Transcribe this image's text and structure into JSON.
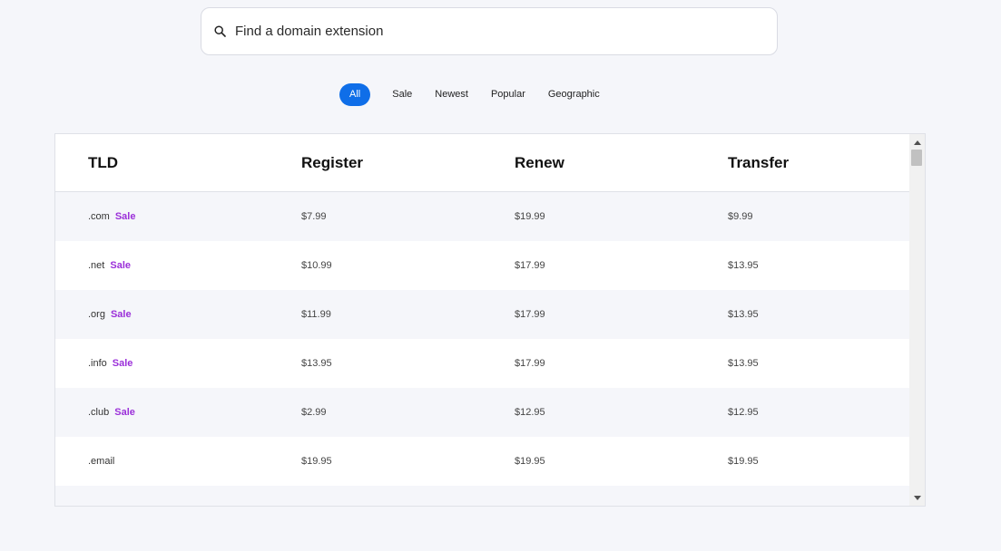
{
  "search": {
    "placeholder": "Find a domain extension",
    "value": ""
  },
  "filters": [
    {
      "label": "All",
      "active": true
    },
    {
      "label": "Sale",
      "active": false
    },
    {
      "label": "Newest",
      "active": false
    },
    {
      "label": "Popular",
      "active": false
    },
    {
      "label": "Geographic",
      "active": false
    }
  ],
  "table": {
    "headers": [
      "TLD",
      "Register",
      "Renew",
      "Transfer"
    ],
    "sale_label": "Sale",
    "rows": [
      {
        "tld": ".com",
        "sale": true,
        "register": "$7.99",
        "renew": "$19.99",
        "transfer": "$9.99"
      },
      {
        "tld": ".net",
        "sale": true,
        "register": "$10.99",
        "renew": "$17.99",
        "transfer": "$13.95"
      },
      {
        "tld": ".org",
        "sale": true,
        "register": "$11.99",
        "renew": "$17.99",
        "transfer": "$13.95"
      },
      {
        "tld": ".info",
        "sale": true,
        "register": "$13.95",
        "renew": "$17.99",
        "transfer": "$13.95"
      },
      {
        "tld": ".club",
        "sale": true,
        "register": "$2.99",
        "renew": "$12.95",
        "transfer": "$12.95"
      },
      {
        "tld": ".email",
        "sale": false,
        "register": "$19.95",
        "renew": "$19.95",
        "transfer": "$19.95"
      }
    ]
  },
  "colors": {
    "accent": "#0f6ee8",
    "sale": "#9b30d9",
    "page_background": "#f5f6fa"
  },
  "icons": {
    "search": "search-icon",
    "scroll_up": "triangle-up-icon",
    "scroll_down": "triangle-down-icon"
  }
}
